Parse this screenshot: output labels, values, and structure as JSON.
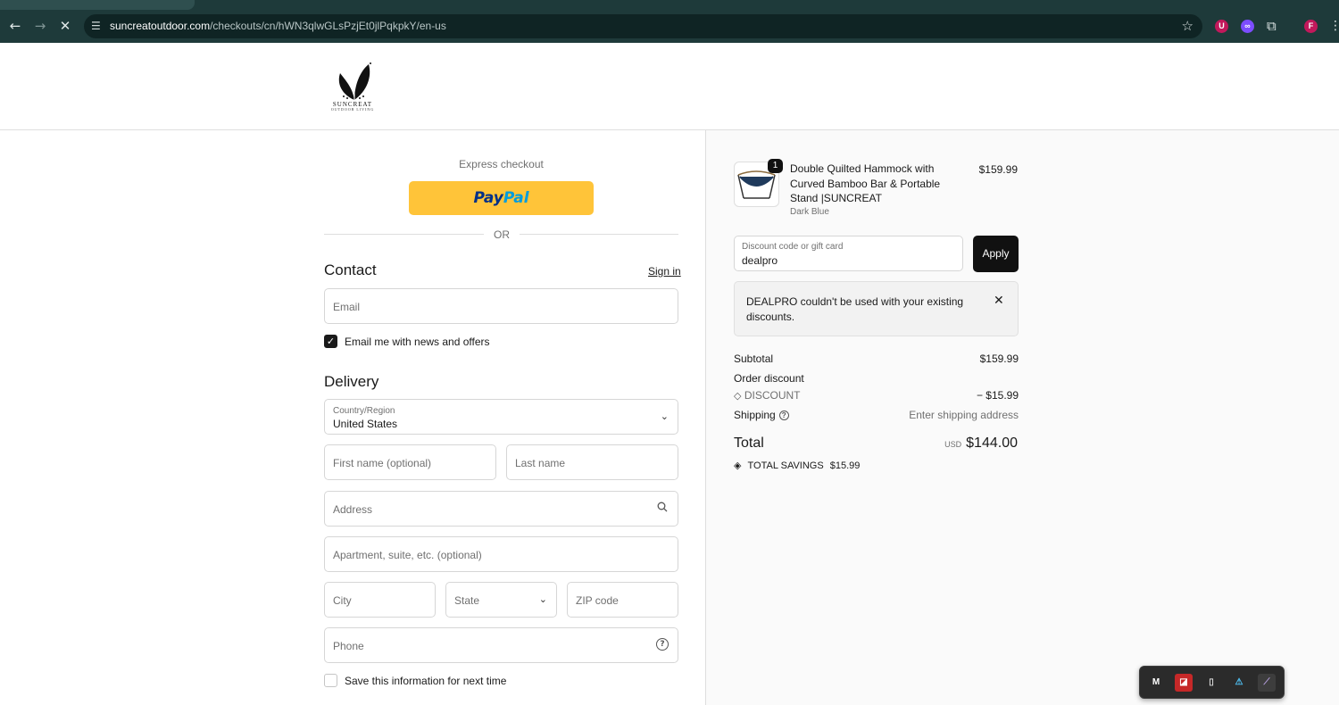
{
  "browser": {
    "url_host": "suncreatoutdoor.com",
    "url_path": "/checkouts/cn/hWN3qlwGLsPzjEt0jlPqkpkY/en-us",
    "profile_initial": "F"
  },
  "header": {
    "brand": "SUNCREAT",
    "tagline": "OUTDOOR LIVING"
  },
  "express": {
    "label": "Express checkout",
    "paypal_pay": "Pay",
    "paypal_pal": "Pal",
    "or": "OR"
  },
  "contact": {
    "title": "Contact",
    "signin": "Sign in",
    "email_placeholder": "Email",
    "newsletter_label": "Email me with news and offers",
    "newsletter_checked": true
  },
  "delivery": {
    "title": "Delivery",
    "country_label": "Country/Region",
    "country_value": "United States",
    "first_name": "First name (optional)",
    "last_name": "Last name",
    "address": "Address",
    "apartment": "Apartment, suite, etc. (optional)",
    "city": "City",
    "state": "State",
    "zip": "ZIP code",
    "phone": "Phone",
    "save_info_label": "Save this information for next time",
    "save_info_checked": false
  },
  "summary": {
    "product": {
      "quantity": "1",
      "name": "Double Quilted Hammock with Curved Bamboo Bar & Portable Stand |SUNCREAT",
      "variant": "Dark Blue",
      "price": "$159.99"
    },
    "discount_label": "Discount code or gift card",
    "discount_value": "dealpro",
    "apply": "Apply",
    "notice": "DEALPRO couldn't be used with your existing discounts.",
    "subtotal_label": "Subtotal",
    "subtotal_value": "$159.99",
    "order_discount_label": "Order discount",
    "discount_code": "DISCOUNT",
    "discount_amount": "− $15.99",
    "shipping_label": "Shipping",
    "shipping_value": "Enter shipping address",
    "total_label": "Total",
    "currency": "USD",
    "total_value": "$144.00",
    "savings_label": "TOTAL SAVINGS",
    "savings_value": "$15.99"
  },
  "colors": {
    "paypal_yellow": "#ffc439",
    "browser_toolbar": "#1e3a3a",
    "apply_button": "#111111"
  }
}
